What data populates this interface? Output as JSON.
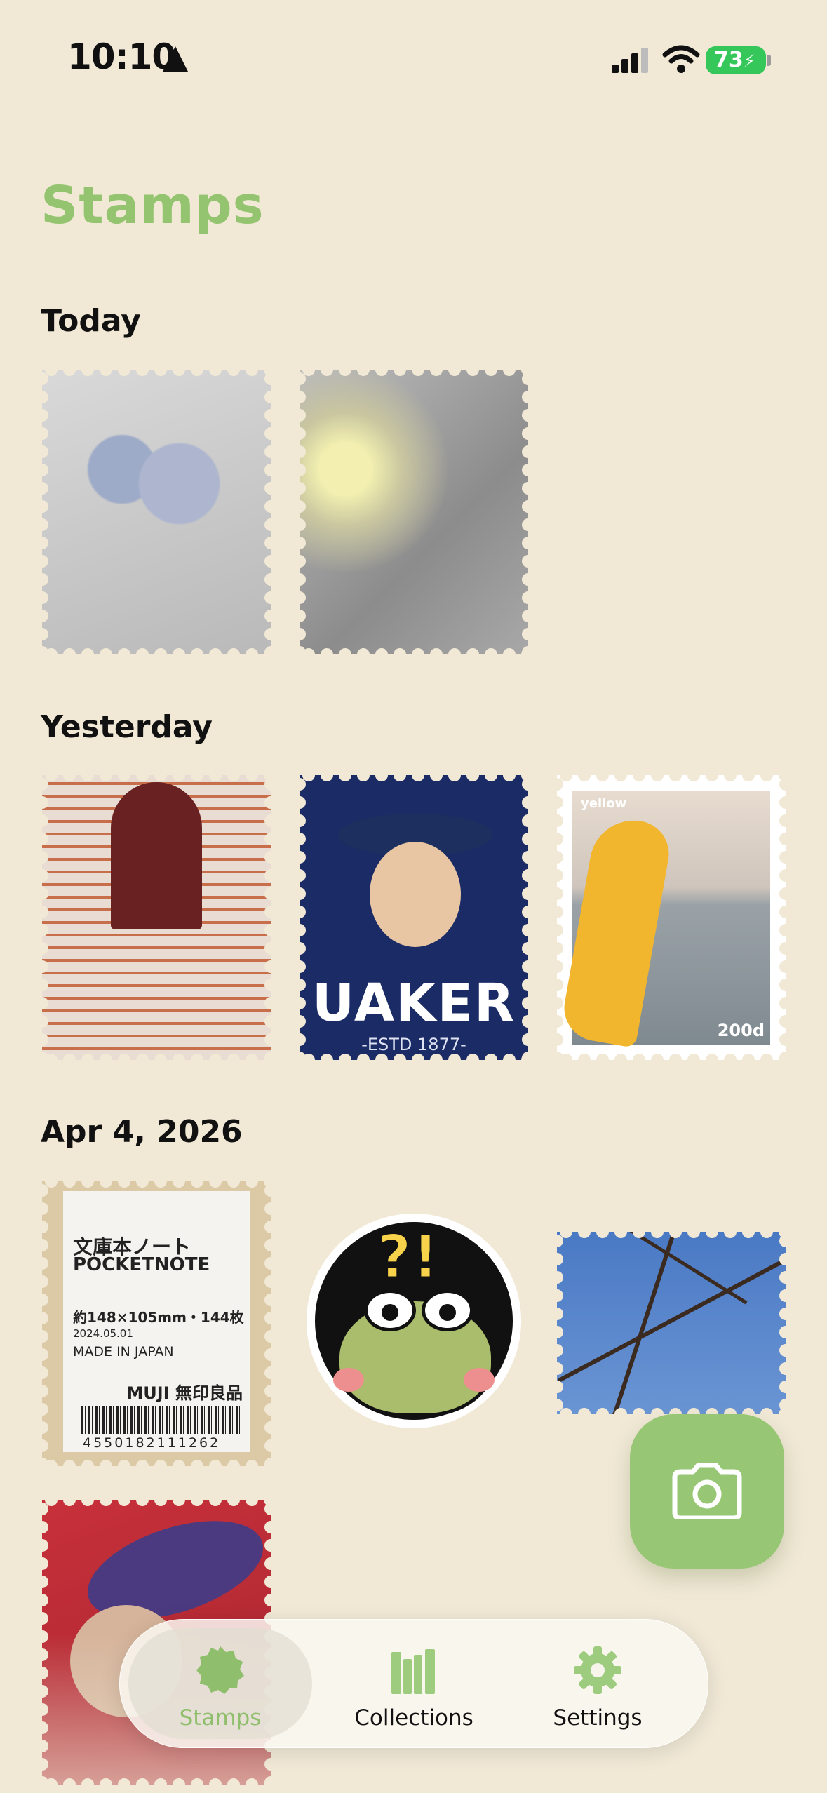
{
  "status_bar": {
    "time": "10:10",
    "battery": "73"
  },
  "page": {
    "title": "Stamps"
  },
  "sections": [
    {
      "heading": "Today"
    },
    {
      "heading": "Yesterday"
    },
    {
      "heading": "Apr 4, 2026"
    }
  ],
  "stamps": {
    "quaker": {
      "text": "UAKER",
      "sub": "-ESTD 1877-"
    },
    "yellow": {
      "label": "yellow",
      "value": "200d"
    },
    "note": {
      "line1": "文庫本ノート",
      "line2": "POCKETNOTE",
      "line3": "約148×105mm・144枚",
      "line4": "2024.05.01",
      "line5": "MADE IN JAPAN",
      "line6": "MUJI 無印良品",
      "barcode": "4550182111262"
    },
    "frog": {
      "marks": "?!"
    }
  },
  "fab": {
    "icon": "camera-icon"
  },
  "tabbar": {
    "tabs": [
      {
        "label": "Stamps",
        "icon": "stamp-icon",
        "active": true
      },
      {
        "label": "Collections",
        "icon": "books-icon",
        "active": false
      },
      {
        "label": "Settings",
        "icon": "gear-icon",
        "active": false
      }
    ]
  },
  "colors": {
    "background": "#f1e9d6",
    "accent": "#94c46f",
    "battery": "#35c759"
  }
}
